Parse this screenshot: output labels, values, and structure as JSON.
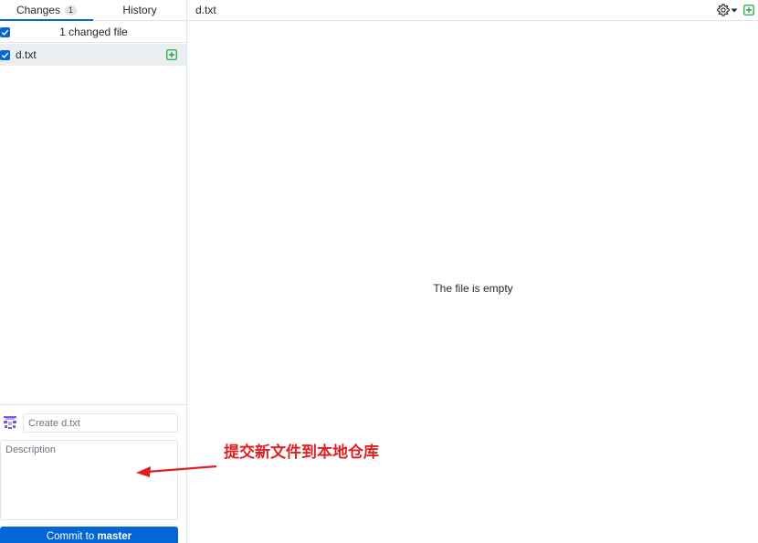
{
  "tabs": [
    {
      "label": "Changes",
      "count": "1"
    },
    {
      "label": "History"
    }
  ],
  "changes": {
    "summary": "1 changed file",
    "files": [
      {
        "name": "d.txt",
        "status": "added",
        "checked": true
      }
    ]
  },
  "diff": {
    "path": "d.txt",
    "empty_message": "The file is empty"
  },
  "commit": {
    "summary_placeholder": "Create d.txt",
    "description_placeholder": "Description",
    "button_prefix": "Commit to",
    "branch": "master"
  },
  "annotation": {
    "text": "提交新文件到本地仓库",
    "color": "#e02020"
  },
  "colors": {
    "accent": "#0366d6",
    "added": "#28a745"
  },
  "icons": [
    "checkbox-checked-icon",
    "file-added-icon",
    "gear-icon",
    "caret-down-icon",
    "avatar-icon"
  ]
}
